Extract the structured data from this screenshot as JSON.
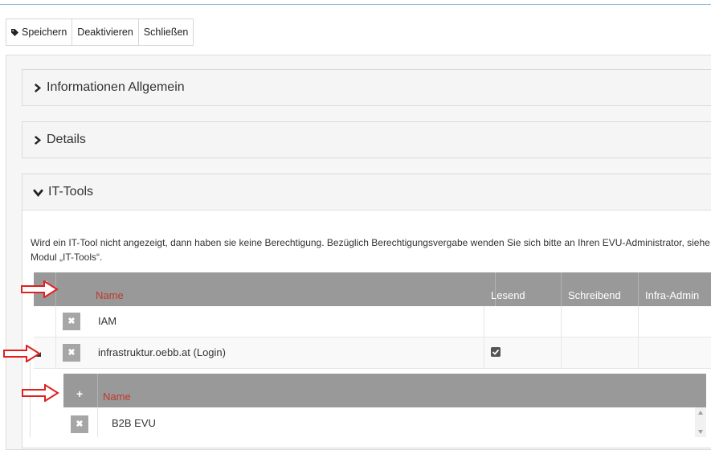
{
  "toolbar": {
    "save_label": "Speichern",
    "deactivate_label": "Deaktivieren",
    "close_label": "Schließen"
  },
  "sections": {
    "general": "Informationen Allgemein",
    "details": "Details",
    "it_tools": "IT-Tools"
  },
  "info_text": "Wird ein IT-Tool nicht angezeigt, dann haben sie keine Berechtigung. Bezüglich Berechtigungsvergabe wenden Sie sich bitte an Ihren EVU-Administrator, siehe Modul „IT-Tools“.",
  "grid": {
    "add_symbol": "+",
    "columns": [
      "Name",
      "Lesend",
      "Schreibend",
      "Infra-Admin"
    ],
    "rows": [
      {
        "name": "IAM",
        "lesend": false
      },
      {
        "name": "infrastruktur.oebb.at (Login)",
        "lesend": true
      }
    ]
  },
  "subgrid": {
    "add_symbol": "+",
    "column_name": "Name",
    "rows": [
      {
        "name": "B2B EVU"
      }
    ]
  },
  "delete_symbol": "✖",
  "colors": {
    "header_bg": "#999999",
    "name_header_text": "#c0392b",
    "annotation_arrow": "#e02020"
  }
}
